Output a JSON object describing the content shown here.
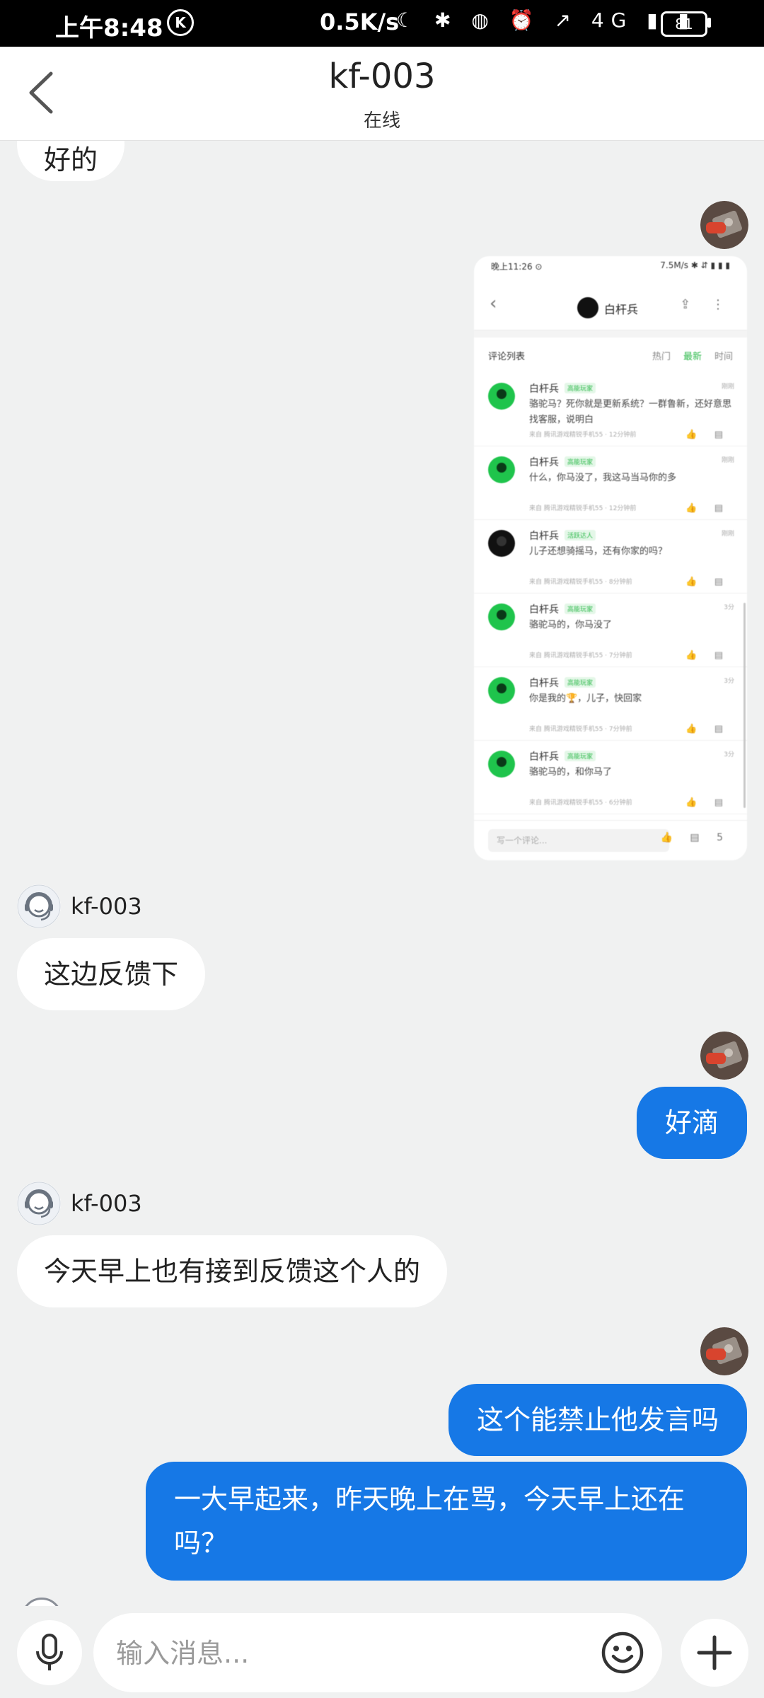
{
  "status_bar": {
    "time": "上午8:48",
    "k_badge": "K",
    "speed": "0.5K/s",
    "icons_text": "☾ ✱ ◍ ⏰ ↗ 4G ▮ ▮",
    "battery": "81"
  },
  "nav": {
    "title": "kf-003",
    "subtitle": "在线"
  },
  "messages": {
    "m0": "好的",
    "agent_name_1": "kf-003",
    "m1": "这边反馈下",
    "m2": "好滴",
    "agent_name_2": "kf-003",
    "m3": "今天早上也有接到反馈这个人的",
    "m4": "这个能禁止他发言吗",
    "m5": "一大早起来，昨天晚上在骂，今天早上还在吗？"
  },
  "screenshot": {
    "status_left": "晚上11:26 ⊙",
    "status_right": "7.5M/s ✱ ⇵ ▮ ▮ ▮",
    "header_name": "白杆兵",
    "filter_title": "评论列表",
    "filter_opts": [
      "热门",
      "最新",
      "时间"
    ],
    "comments": [
      {
        "name": "白杆兵",
        "tag": "高能玩家",
        "time": "刚刚",
        "text": "骆驼马？死你就是更新系统？一群鲁新，还好意思找客服，说明白",
        "meta": "来自 腾讯游戏精锐手机55 · 12分钟前"
      },
      {
        "name": "白杆兵",
        "tag": "高能玩家",
        "time": "刚刚",
        "text": "什么，你马没了，我这马当马你的多",
        "meta": "来自 腾讯游戏精锐手机55 · 12分钟前"
      },
      {
        "name": "白杆兵",
        "tag": "活跃达人",
        "time": "刚刚",
        "text": "儿子还想骑摇马，还有你家的吗？",
        "meta": "来自 腾讯游戏精锐手机55 · 8分钟前"
      },
      {
        "name": "白杆兵",
        "tag": "高能玩家",
        "time": "3分",
        "text": "骆驼马的，你马没了",
        "meta": "来自 腾讯游戏精锐手机55 · 7分钟前"
      },
      {
        "name": "白杆兵",
        "tag": "高能玩家",
        "time": "3分",
        "text": "你是我的🏆，儿子，快回家",
        "meta": "来自 腾讯游戏精锐手机55 · 7分钟前"
      },
      {
        "name": "白杆兵",
        "tag": "高能玩家",
        "time": "3分",
        "text": "骆驼马的，和你马了",
        "meta": "来自 腾讯游戏精锐手机55 · 6分钟前"
      }
    ],
    "input_placeholder": "写一个评论...",
    "bottom_count": "5"
  },
  "input_bar": {
    "placeholder": "输入消息..."
  },
  "colors": {
    "bubble_blue": "#1678e6",
    "background": "#f0f1f1",
    "accent_green": "#2cb94a"
  }
}
